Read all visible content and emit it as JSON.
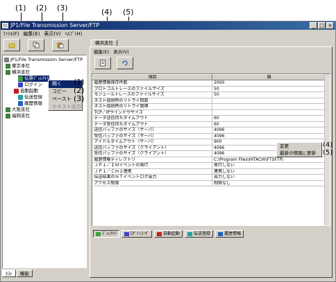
{
  "callouts": [
    "(1)",
    "(2)",
    "(3)",
    "(4)",
    "(5)"
  ],
  "window": {
    "title": "JP1/File Transmission Server/FTP",
    "controls": [
      "_",
      "□",
      "×"
    ]
  },
  "menubar": [
    "ﾌｧｲﾙ(F)",
    "編集(E)",
    "表示(V)",
    "ﾍﾙﾌﾟ(H)"
  ],
  "tree": {
    "root": "JP1/File Transmission Server/FTP",
    "nodes": [
      "東京本社",
      "横浜支社",
      "伝票ﾃﾞｨﾚｸﾄﾘ",
      "ログイン",
      "自動起動",
      "伝送登録",
      "履歴情報",
      "大阪支社",
      "福岡支社"
    ]
  },
  "context_menu": {
    "items": [
      "開く",
      "コピー",
      "ペースト",
      "テキスト出力"
    ],
    "markers": [
      "(1)",
      "(2)",
      "(3)"
    ]
  },
  "bottom_tabs": [
    "ﾈｽﾄ",
    "機能"
  ],
  "main_tab": "横浜支社",
  "menubar2": [
    "編集(E)",
    "表示(V)"
  ],
  "table": {
    "headers": [
      "項目",
      "値"
    ],
    "rows": [
      [
        "履歴情報保存件数",
        "2000"
      ],
      [
        "プロトコルトレースのファイルサイズ",
        "50"
      ],
      [
        "モジュールトレースのファイルサイズ",
        "50"
      ],
      [
        "ネスト接続時のリトライ回数",
        ""
      ],
      [
        "ネスト接続時のリトライ間隔",
        ""
      ],
      [
        "TCP／IPウインドウサイズ",
        ""
      ],
      [
        "データ送信待ちタイムアウト",
        "60"
      ],
      [
        "データ受信待ちタイムアウト",
        "60"
      ],
      [
        "送信バッファのサイズ（サーバ）",
        "4096"
      ],
      [
        "受信バッファのサイズ（サーバ）",
        "4096"
      ],
      [
        "アイドルタイムアウト（サーバ）",
        "900"
      ],
      [
        "送信バッファのサイズ（クライアント）",
        "4096"
      ],
      [
        "受信バッファのサイズ（クライアント）",
        "4096"
      ],
      [
        "履歴情報ディレクトリ",
        "C:\\Program Files\\HITACHI\\FTSFTP\\"
      ],
      [
        "ＪＰ１／ＩＭイベントの発行",
        "発行しない"
      ],
      [
        "ＪＰ１／Ｃｍ２連携",
        "連携しない"
      ],
      [
        "伝送結果のＮＴイベントログ出力",
        "出力しない"
      ],
      [
        "アクセス制限",
        "制限なし"
      ]
    ]
  },
  "context_menu2": {
    "items": [
      "変更",
      "最新の情報に更新"
    ],
    "markers": [
      "(4)",
      "(5)"
    ]
  },
  "bottom_buttons": [
    "ﾃﾞｨﾚｸﾄﾘ",
    "ﾛｸﾞｲﾝﾕｰｻﾞ",
    "自動起動",
    "伝送登録",
    "履歴情報"
  ]
}
